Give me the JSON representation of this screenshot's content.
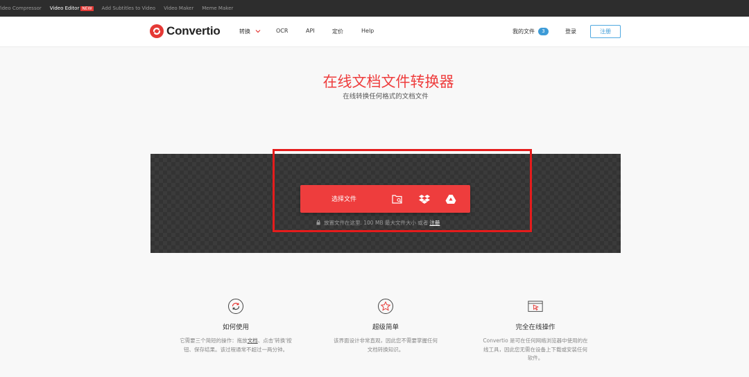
{
  "topstrip": {
    "links": [
      {
        "label": "Video Compressor",
        "active": false
      },
      {
        "label": "Video Editor",
        "active": true,
        "badge": "NEW"
      },
      {
        "label": "Add Subtitles to Video",
        "active": false
      },
      {
        "label": "Video Maker",
        "active": false
      },
      {
        "label": "Meme Maker",
        "active": false
      }
    ]
  },
  "header": {
    "logo_text": "Convertio",
    "nav": {
      "convert": "转换",
      "ocr": "OCR",
      "api": "API",
      "pricing": "定价",
      "help": "Help"
    },
    "my_files": "我的文件",
    "my_files_count": "3",
    "login": "登录",
    "signup": "注册"
  },
  "hero": {
    "title": "在线文档文件转换器",
    "subtitle": "在线转换任何格式的文档文件"
  },
  "upload": {
    "choose_label": "选择文件",
    "sources": [
      "folder-search-icon",
      "dropbox-icon",
      "google-drive-icon"
    ],
    "note_text": "放置文件在这里. 100 MB 最大文件大小 或者",
    "note_link": "注册"
  },
  "features": [
    {
      "icon": "refresh-icon",
      "title": "如何使用",
      "desc_1": "它需要三个简短的操作：拖放",
      "desc_link": "文档",
      "desc_2": "、点击'转换'按钮、保存结果。该过程通常不超过一两分钟。"
    },
    {
      "icon": "star-icon",
      "title": "超级简单",
      "desc": "该界面设计非常直观，因此您不需要掌握任何文档转换知识。"
    },
    {
      "icon": "browser-cursor-icon",
      "title": "完全在线操作",
      "desc": "Convertio 是可在任何网络浏览器中使用的在线工具，因此您无需在设备上下载或安装任何软件。"
    }
  ],
  "colors": {
    "brand_red": "#ee3d3d",
    "highlight_red": "#e51c1c",
    "link_blue": "#3d9bd7",
    "dark_strip": "#2d2d2d"
  }
}
